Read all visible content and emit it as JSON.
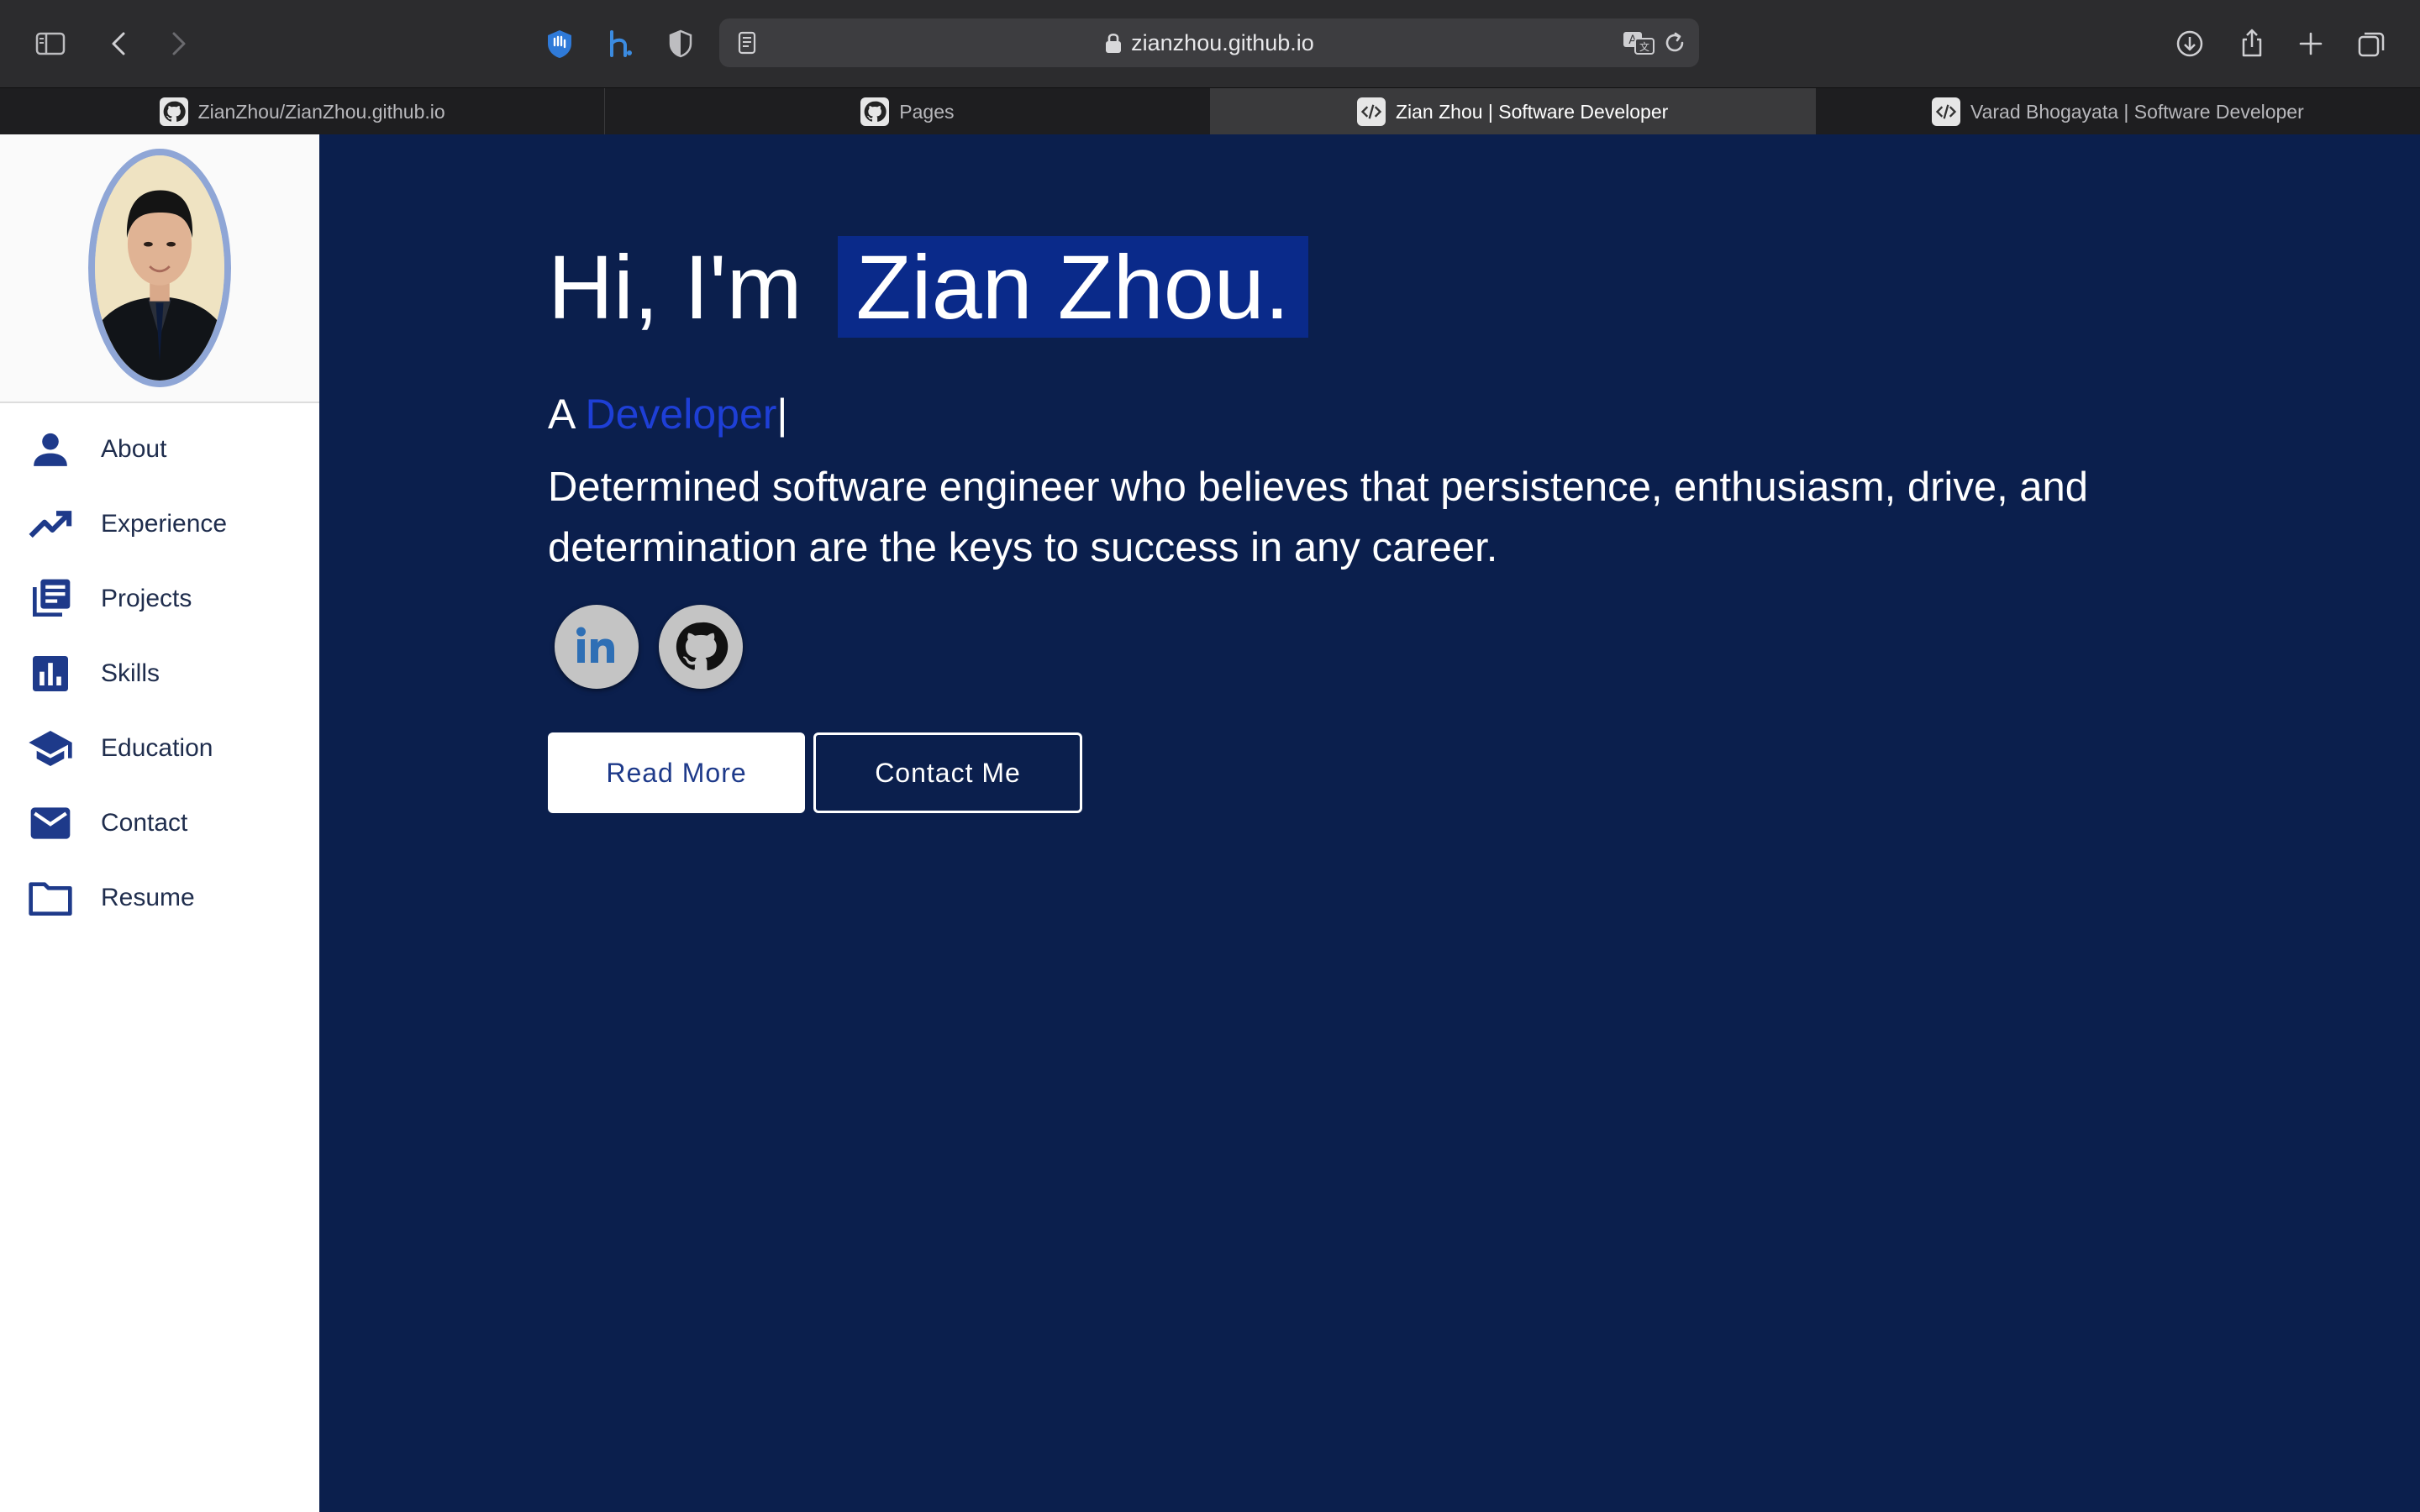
{
  "browser": {
    "url": "zianzhou.github.io",
    "tabs": [
      {
        "label": "ZianZhou/ZianZhou.github.io",
        "icon": "github-icon",
        "active": false
      },
      {
        "label": "Pages",
        "icon": "github-icon",
        "active": false
      },
      {
        "label": "Zian Zhou | Software Developer",
        "icon": "code-icon",
        "active": true
      },
      {
        "label": "Varad Bhogayata | Software Developer",
        "icon": "code-icon",
        "active": false
      }
    ]
  },
  "sidebar": {
    "items": [
      {
        "label": "About",
        "icon": "person-icon"
      },
      {
        "label": "Experience",
        "icon": "trending-up-icon"
      },
      {
        "label": "Projects",
        "icon": "library-books-icon"
      },
      {
        "label": "Skills",
        "icon": "bar-chart-icon"
      },
      {
        "label": "Education",
        "icon": "school-icon"
      },
      {
        "label": "Contact",
        "icon": "mail-icon"
      },
      {
        "label": "Resume",
        "icon": "folder-icon"
      }
    ]
  },
  "hero": {
    "greeting": "Hi, I'm",
    "name": "Zian Zhou.",
    "typed_prefix": "A",
    "typed_role": "Developer",
    "typed_cursor": "|",
    "tagline": "Determined software engineer who believes that persistence, enthusiasm, drive, and determination are the keys to success in any career.",
    "read_more": "Read More",
    "contact_me": "Contact Me",
    "social_links": [
      "linkedin-icon",
      "github-icon"
    ]
  },
  "colors": {
    "hero_bg": "#0b1f4d",
    "name_highlight": "#0a2a8a",
    "role_text": "#1e3fd6",
    "sidebar_icon": "#1e3a8a"
  }
}
